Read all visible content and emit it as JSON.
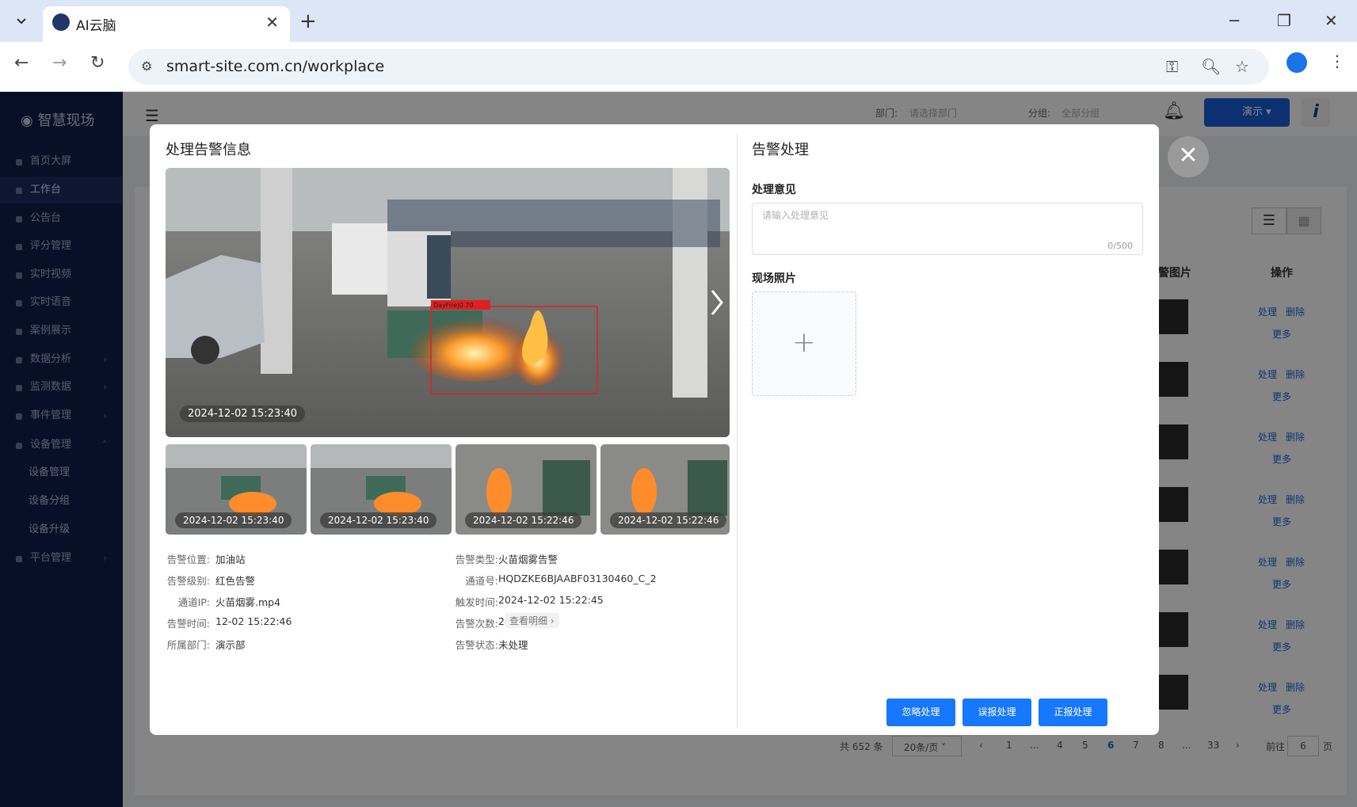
{
  "browser": {
    "tab_title": "AI云脑",
    "url": "smart-site.com.cn/workplace"
  },
  "sidebar": {
    "brand": "智慧现场",
    "items": [
      {
        "label": "首页大屏"
      },
      {
        "label": "工作台"
      },
      {
        "label": "公告台"
      },
      {
        "label": "评分管理"
      },
      {
        "label": "实时视频"
      },
      {
        "label": "实时语音"
      },
      {
        "label": "案例展示"
      },
      {
        "label": "数据分析"
      },
      {
        "label": "监测数据"
      },
      {
        "label": "事件管理"
      },
      {
        "label": "设备管理"
      },
      {
        "label": "设备管理"
      },
      {
        "label": "设备分组"
      },
      {
        "label": "设备升级"
      },
      {
        "label": "平台管理"
      }
    ]
  },
  "background": {
    "col_image": "警图片",
    "col_ops": "操作",
    "row_actions": {
      "process": "处理",
      "delete": "删除",
      "more": "更多"
    },
    "topbar": {
      "dept_label": "部门:",
      "dept_placeholder": "请选择部门",
      "group_label": "分组:",
      "group_value": "全部分组",
      "user": "演示"
    },
    "pager": {
      "total": "共 652 条",
      "size": "20条/页",
      "goto_prefix": "前往",
      "goto_value": "6",
      "goto_suffix": "页",
      "pages": [
        "1",
        "...",
        "4",
        "5",
        "6",
        "7",
        "8",
        "...",
        "33"
      ]
    }
  },
  "modal": {
    "left_title": "处理告警信息",
    "right_title": "告警处理",
    "main_timestamp": "2024-12-02 15:23:40",
    "detection_label": "DayFire|0.70",
    "thumbnails": [
      {
        "timestamp": "2024-12-02 15:23:40"
      },
      {
        "timestamp": "2024-12-02 15:23:40"
      },
      {
        "timestamp": "2024-12-02 15:22:46"
      },
      {
        "timestamp": "2024-12-02 15:22:46"
      }
    ],
    "info_left": [
      {
        "label": "告警位置:",
        "value": "加油站"
      },
      {
        "label": "告警级别:",
        "value": "红色告警"
      },
      {
        "label": "通道IP:",
        "value": "火苗烟雾.mp4"
      },
      {
        "label": "告警时间:",
        "value": "12-02 15:22:46"
      },
      {
        "label": "所属部门:",
        "value": "演示部"
      }
    ],
    "info_right": [
      {
        "label": "告警类型:",
        "value": "火苗烟雾告警"
      },
      {
        "label": "通道号:",
        "value": "HQDZKE6BJAABF03130460_C_2"
      },
      {
        "label": "触发时间:",
        "value": "2024-12-02 15:22:45"
      },
      {
        "label": "告警次数:",
        "value": "2"
      },
      {
        "label": "告警状态:",
        "value": "未处理"
      }
    ],
    "detail_link": "查看明细",
    "form": {
      "opinion_label": "处理意见",
      "opinion_placeholder": "请输入处理意见",
      "opinion_count": "0/500",
      "photo_label": "现场照片"
    },
    "buttons": {
      "ignore": "忽略处理",
      "false_alarm": "误报处理",
      "confirm": "正报处理"
    }
  }
}
